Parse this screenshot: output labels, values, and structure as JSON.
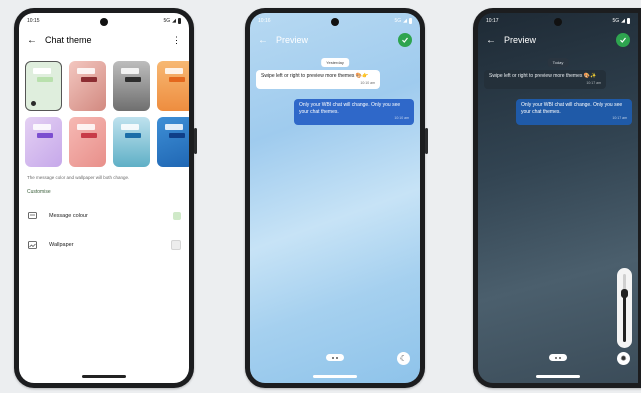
{
  "phone1": {
    "status_time": "10:15",
    "status_network": "5G",
    "title": "Chat theme",
    "note": "The message color and wallpaper will both change.",
    "section": "Customise",
    "rows": [
      {
        "label": "Message colour"
      },
      {
        "label": "Wallpaper"
      }
    ]
  },
  "phone2": {
    "status_time": "10:16",
    "status_network": "5G",
    "title": "Preview",
    "date_chip": "Yesterday",
    "incoming": {
      "text": "Swipe left or right to preview more themes 🎨👉",
      "time": "10:10 am"
    },
    "outgoing": {
      "text": "Only your WBI chat will change. Only you see your chat themes.",
      "time": "10:10 am"
    }
  },
  "phone3": {
    "status_time": "10:17",
    "status_network": "5G",
    "title": "Preview",
    "date_chip": "Today",
    "incoming": {
      "text": "Swipe left or right to preview more themes 🎨✨",
      "time": "10:17 am"
    },
    "outgoing": {
      "text": "Only your WBI chat will change. Only you see your chat themes.",
      "time": "10:17 am"
    },
    "brightness_level": 0.7
  },
  "colors": {
    "accent_green": "#2ea44f",
    "light_bubble_out": "#2f68c9",
    "dark_bubble_out": "#1f5aa8"
  }
}
